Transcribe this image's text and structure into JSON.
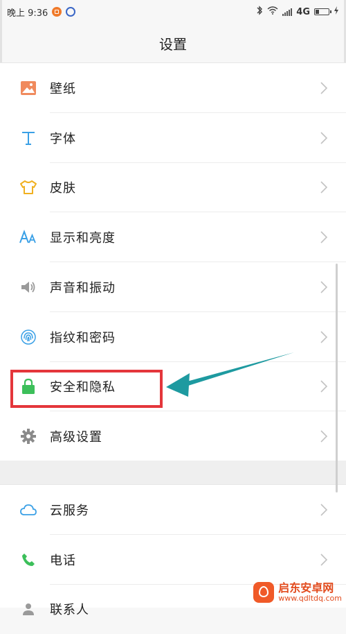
{
  "status_bar": {
    "time": "晚上 9:36",
    "network": "4G"
  },
  "header": {
    "title": "设置"
  },
  "settings_group_1": [
    {
      "label": "壁纸",
      "icon": "wallpaper-icon"
    },
    {
      "label": "字体",
      "icon": "font-icon"
    },
    {
      "label": "皮肤",
      "icon": "shirt-icon"
    },
    {
      "label": "显示和亮度",
      "icon": "text-size-icon"
    },
    {
      "label": "声音和振动",
      "icon": "speaker-icon"
    },
    {
      "label": "指纹和密码",
      "icon": "fingerprint-icon"
    },
    {
      "label": "安全和隐私",
      "icon": "lock-icon"
    },
    {
      "label": "高级设置",
      "icon": "gear-icon"
    }
  ],
  "settings_group_2": [
    {
      "label": "云服务",
      "icon": "cloud-icon"
    },
    {
      "label": "电话",
      "icon": "phone-icon"
    },
    {
      "label": "联系人",
      "icon": "contact-icon"
    }
  ],
  "watermark": {
    "title": "启东安卓网",
    "url": "www.qdltdq.com"
  },
  "colors": {
    "highlight": "#e4363b",
    "arrow": "#1e9aa0",
    "accent_blue": "#3aa0e6"
  }
}
